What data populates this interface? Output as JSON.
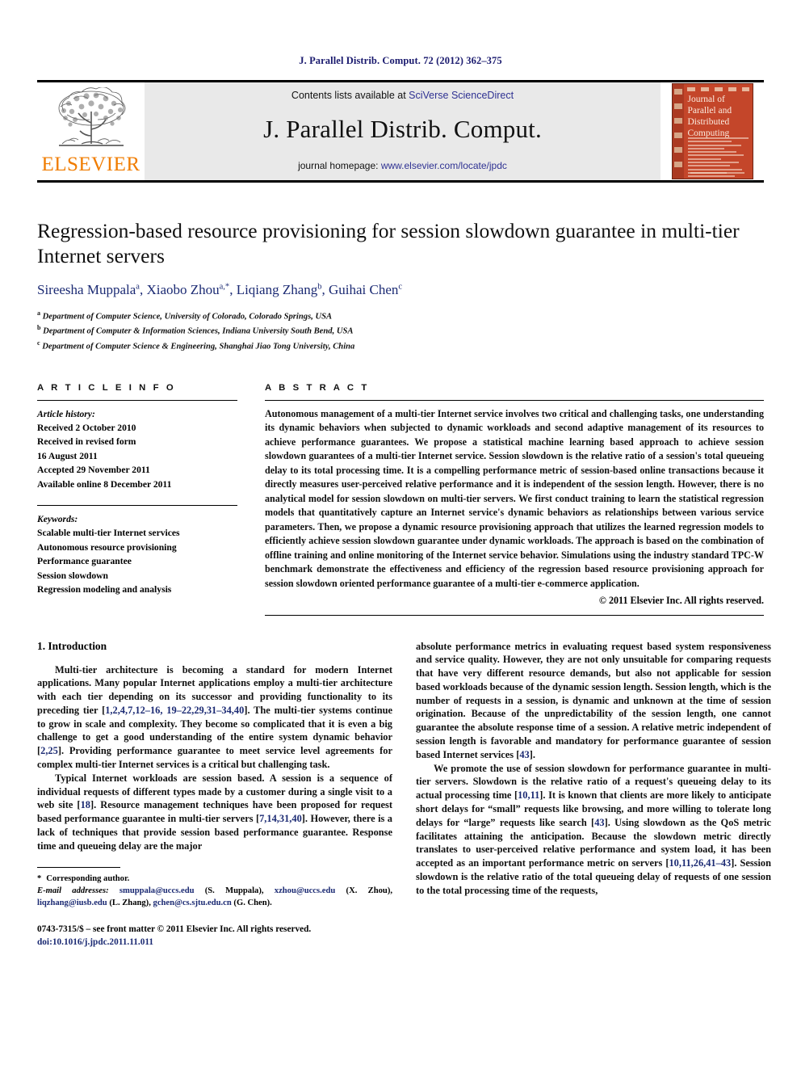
{
  "running_head": "J. Parallel Distrib. Comput. 72 (2012) 362–375",
  "masthead": {
    "publisher_name": "ELSEVIER",
    "contents_prefix": "Contents lists available at ",
    "contents_link": "SciVerse ScienceDirect",
    "journal_title": "J. Parallel Distrib. Comput.",
    "homepage_prefix": "journal homepage: ",
    "homepage_link": "www.elsevier.com/locate/jpdc",
    "cover_title": "Journal of Parallel and Distributed Computing",
    "link_color": "#2e3192",
    "elsevier_orange": "#f07c00"
  },
  "article": {
    "title": "Regression-based resource provisioning for session slowdown guarantee in multi-tier Internet servers",
    "authors": [
      {
        "name": "Sireesha Muppala",
        "sup": "a",
        "sep": ", "
      },
      {
        "name": "Xiaobo Zhou",
        "sup": "a,*",
        "sep": ", "
      },
      {
        "name": "Liqiang Zhang",
        "sup": "b",
        "sep": ", "
      },
      {
        "name": "Guihai Chen",
        "sup": "c",
        "sep": ""
      }
    ],
    "affiliations": [
      {
        "sup": "a",
        "text": "Department of Computer Science, University of Colorado, Colorado Springs, USA"
      },
      {
        "sup": "b",
        "text": "Department of Computer & Information Sciences, Indiana University South Bend, USA"
      },
      {
        "sup": "c",
        "text": "Department of Computer Science & Engineering, Shanghai Jiao Tong University, China"
      }
    ]
  },
  "info": {
    "heading": "A R T I C L E   I N F O",
    "history_label": "Article history:",
    "history": [
      "Received 2 October 2010",
      "Received in revised form",
      "16 August 2011",
      "Accepted 29 November 2011",
      "Available online 8 December 2011"
    ],
    "keywords_label": "Keywords:",
    "keywords": [
      "Scalable multi-tier Internet services",
      "Autonomous resource provisioning",
      "Performance guarantee",
      "Session slowdown",
      "Regression modeling and analysis"
    ]
  },
  "abstract": {
    "heading": "A B S T R A C T",
    "text": "Autonomous management of a multi-tier Internet service involves two critical and challenging tasks, one understanding its dynamic behaviors when subjected to dynamic workloads and second adaptive management of its resources to achieve performance guarantees. We propose a statistical machine learning based approach to achieve session slowdown guarantees of a multi-tier Internet service. Session slowdown is the relative ratio of a session's total queueing delay to its total processing time. It is a compelling performance metric of session-based online transactions because it directly measures user-perceived relative performance and it is independent of the session length. However, there is no analytical model for session slowdown on multi-tier servers. We first conduct training to learn the statistical regression models that quantitatively capture an Internet service's dynamic behaviors as relationships between various service parameters. Then, we propose a dynamic resource provisioning approach that utilizes the learned regression models to efficiently achieve session slowdown guarantee under dynamic workloads. The approach is based on the combination of offline training and online monitoring of the Internet service behavior. Simulations using the industry standard TPC-W benchmark demonstrate the effectiveness and efficiency of the regression based resource provisioning approach for session slowdown oriented performance guarantee of a multi-tier e-commerce application.",
    "copyright": "© 2011 Elsevier Inc. All rights reserved."
  },
  "body": {
    "section_title": "1. Introduction",
    "left_paragraphs": [
      {
        "parts": [
          {
            "t": "Multi-tier architecture is becoming a standard for modern Internet applications. Many popular Internet applications employ a multi-tier architecture with each tier depending on its successor and providing functionality to its preceding tier ["
          },
          {
            "t": "1,2,4,7,12–16, 19–22,29,31–34,40",
            "cite": true
          },
          {
            "t": "]. The multi-tier systems continue to grow in scale and complexity. They become so complicated that it is even a big challenge to get a good understanding of the entire system dynamic behavior ["
          },
          {
            "t": "2,25",
            "cite": true
          },
          {
            "t": "]. Providing performance guarantee to meet service level agreements for complex multi-tier Internet services is a critical but challenging task."
          }
        ]
      },
      {
        "parts": [
          {
            "t": "Typical Internet workloads are session based. A session is a sequence of individual requests of different types made by a customer during a single visit to a web site ["
          },
          {
            "t": "18",
            "cite": true
          },
          {
            "t": "]. Resource management techniques have been proposed for request based performance guarantee in multi-tier servers ["
          },
          {
            "t": "7,14,31,40",
            "cite": true
          },
          {
            "t": "]. However, there is a lack of techniques that provide session based performance guarantee. Response time and queueing delay are the major"
          }
        ]
      }
    ],
    "right_paragraphs": [
      {
        "noindent": true,
        "parts": [
          {
            "t": "absolute performance metrics in evaluating request based system responsiveness and service quality. However, they are not only unsuitable for comparing requests that have very different resource demands, but also not applicable for session based workloads because of the dynamic session length. Session length, which is the number of requests in a session, is dynamic and unknown at the time of session origination. Because of the unpredictability of the session length, one cannot guarantee the absolute response time of a session. A relative metric independent of session length is favorable and mandatory for performance guarantee of session based Internet services ["
          },
          {
            "t": "43",
            "cite": true
          },
          {
            "t": "]."
          }
        ]
      },
      {
        "parts": [
          {
            "t": "We promote the use of session slowdown for performance guarantee in multi-tier servers. Slowdown is the relative ratio of a request's queueing delay to its actual processing time ["
          },
          {
            "t": "10,11",
            "cite": true
          },
          {
            "t": "]. It is known that clients are more likely to anticipate short delays for “small” requests like browsing, and more willing to tolerate long delays for “large” requests like search ["
          },
          {
            "t": "43",
            "cite": true
          },
          {
            "t": "]. Using slowdown as the QoS metric facilitates attaining the anticipation. Because the slowdown metric directly translates to user-perceived relative performance and system load, it has been accepted as an important performance metric on servers ["
          },
          {
            "t": "10,11,26,41–43",
            "cite": true
          },
          {
            "t": "]. Session slowdown is the relative ratio of the total queueing delay of requests of one session to the total processing time of the requests,"
          }
        ]
      }
    ]
  },
  "footnote": {
    "corresponding_star": "*",
    "corresponding_text": "Corresponding author.",
    "emails_label": "E-mail addresses:",
    "emails": [
      {
        "addr": "smuppala@uccs.edu",
        "who": " (S. Muppala), "
      },
      {
        "addr": "xzhou@uccs.edu",
        "who": " (X. Zhou), "
      },
      {
        "addr": "liqzhang@iusb.edu",
        "who": " (L. Zhang), "
      },
      {
        "addr": "gchen@cs.sjtu.edu.cn",
        "who": " (G. Chen)."
      }
    ]
  },
  "imprint": {
    "line1": "0743-7315/$ – see front matter © 2011 Elsevier Inc. All rights reserved.",
    "doi": "doi:10.1016/j.jpdc.2011.11.011"
  }
}
